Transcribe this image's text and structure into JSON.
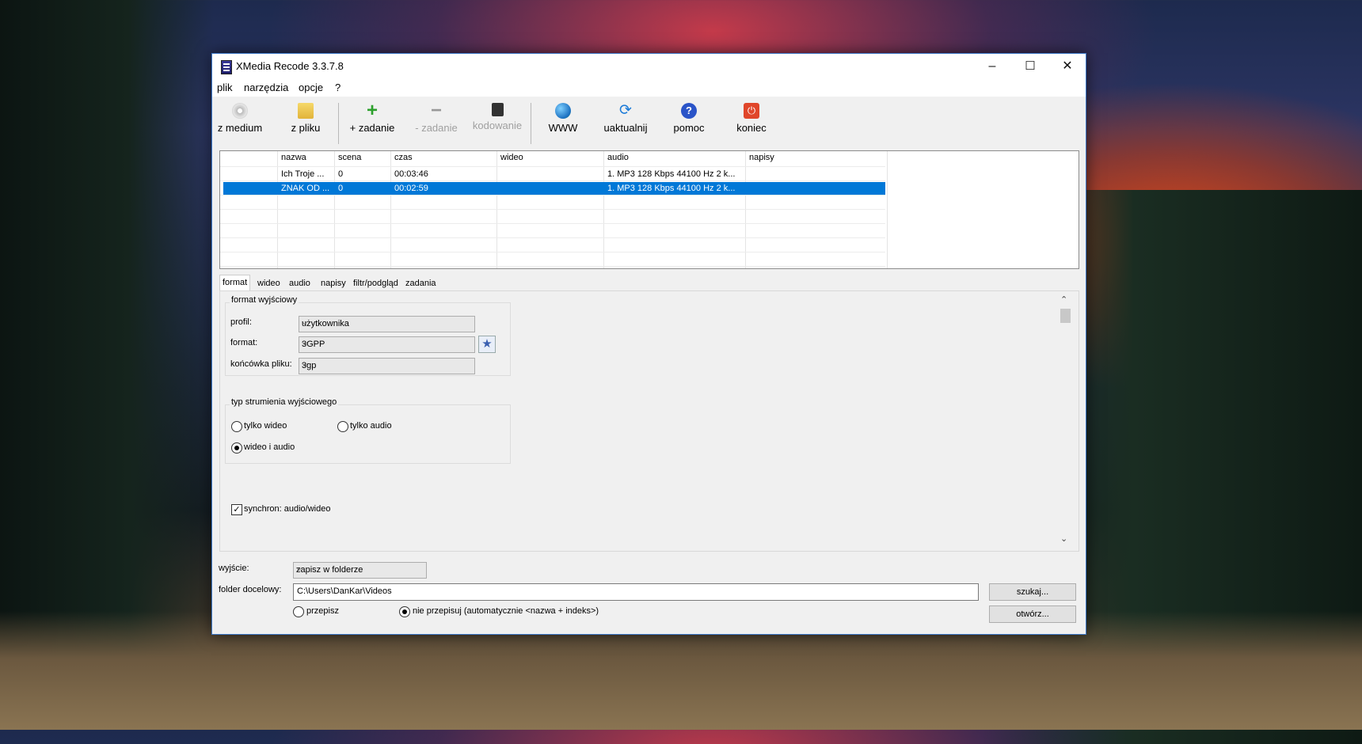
{
  "window": {
    "title": "XMedia Recode 3.3.7.8",
    "minimize": "–",
    "maximize": "☐",
    "close": "✕"
  },
  "menu": [
    "plik",
    "narzędzia",
    "opcje",
    "?"
  ],
  "toolbar": {
    "z_medium": "z medium",
    "z_pliku": "z pliku",
    "add_job": "+ zadanie",
    "remove_job": "- zadanie",
    "encode": "kodowanie",
    "www": "WWW",
    "update": "uaktualnij",
    "help": "pomoc",
    "exit": "koniec"
  },
  "file_list": {
    "columns": [
      "nazwa",
      "scena",
      "czas",
      "wideo",
      "audio",
      "napisy"
    ],
    "rows": [
      {
        "nazwa": "Ich Troje ...",
        "scena": "0",
        "czas": "00:03:46",
        "wideo": "",
        "audio": "1. MP3 128 Kbps 44100 Hz 2 k...",
        "napisy": "",
        "selected": false
      },
      {
        "nazwa": "ZNAK OD ...",
        "scena": "0",
        "czas": "00:02:59",
        "wideo": "",
        "audio": "1. MP3 128 Kbps 44100 Hz 2 k...",
        "napisy": "",
        "selected": true
      }
    ]
  },
  "tabs": [
    "format",
    "wideo",
    "audio",
    "napisy",
    "filtr/podgląd",
    "zadania"
  ],
  "format_tab": {
    "output_format_group": "format wyjściowy",
    "profile_label": "profil:",
    "profile_value": "użytkownika",
    "format_label": "format:",
    "format_value": "3GPP",
    "extension_label": "końcówka pliku:",
    "extension_value": "3gp",
    "stream_group": "typ strumienia wyjściowego",
    "video_only": "tylko wideo",
    "audio_only": "tylko audio",
    "video_audio": "wideo i audio",
    "stream_selected": "wideo i audio",
    "sync_label": "synchron: audio/wideo",
    "sync_checked": true
  },
  "output": {
    "output_label": "wyjście:",
    "output_value": "zapisz w folderze",
    "folder_label": "folder docelowy:",
    "folder_value": "C:\\Users\\DanKar\\Videos",
    "browse_button": "szukaj...",
    "open_button": "otwórz...",
    "overwrite": "przepisz",
    "no_overwrite": "nie przepisuj (automatycznie <nazwa + indeks>)",
    "overwrite_selected": "nie przepisuj (automatycznie <nazwa + indeks>)"
  }
}
